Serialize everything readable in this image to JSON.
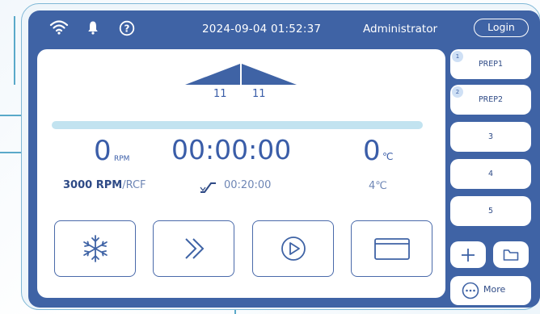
{
  "topbar": {
    "icons": [
      "wifi-icon",
      "bell-icon",
      "help-icon"
    ],
    "datetime": "2024-09-04 01:52:37",
    "user": "Administrator",
    "login_label": "Login"
  },
  "rotor": {
    "left_value": "11",
    "right_value": "11"
  },
  "progress": {
    "fraction": 0.0
  },
  "readouts": {
    "speed_value": "0",
    "speed_unit": "RPM",
    "speed_setting_value": "3000 RPM",
    "speed_setting_suffix": "/RCF",
    "time_value": "00:00:00",
    "time_setting": "00:20:00",
    "temp_value": "0",
    "temp_unit": "℃",
    "temp_setting": "4℃"
  },
  "actions": [
    {
      "name": "cool-button",
      "icon": "snowflake-icon"
    },
    {
      "name": "fast-forward-button",
      "icon": "double-chevron-right-icon"
    },
    {
      "name": "start-button",
      "icon": "play-icon"
    },
    {
      "name": "lid-button",
      "icon": "lid-icon"
    }
  ],
  "sidebar": {
    "slots": [
      {
        "badge": "1",
        "label": "PREP1"
      },
      {
        "badge": "2",
        "label": "PREP2"
      },
      {
        "badge": "",
        "label": "3"
      },
      {
        "badge": "",
        "label": "4"
      },
      {
        "badge": "",
        "label": "5"
      }
    ],
    "more_label": "More"
  },
  "colors": {
    "screen_bg": "#3f63a5",
    "panel_bg": "#ffffff",
    "text_primary": "#3a5da8",
    "progress_track": "#c2e3f0",
    "accent_line": "#5aa9c9"
  }
}
